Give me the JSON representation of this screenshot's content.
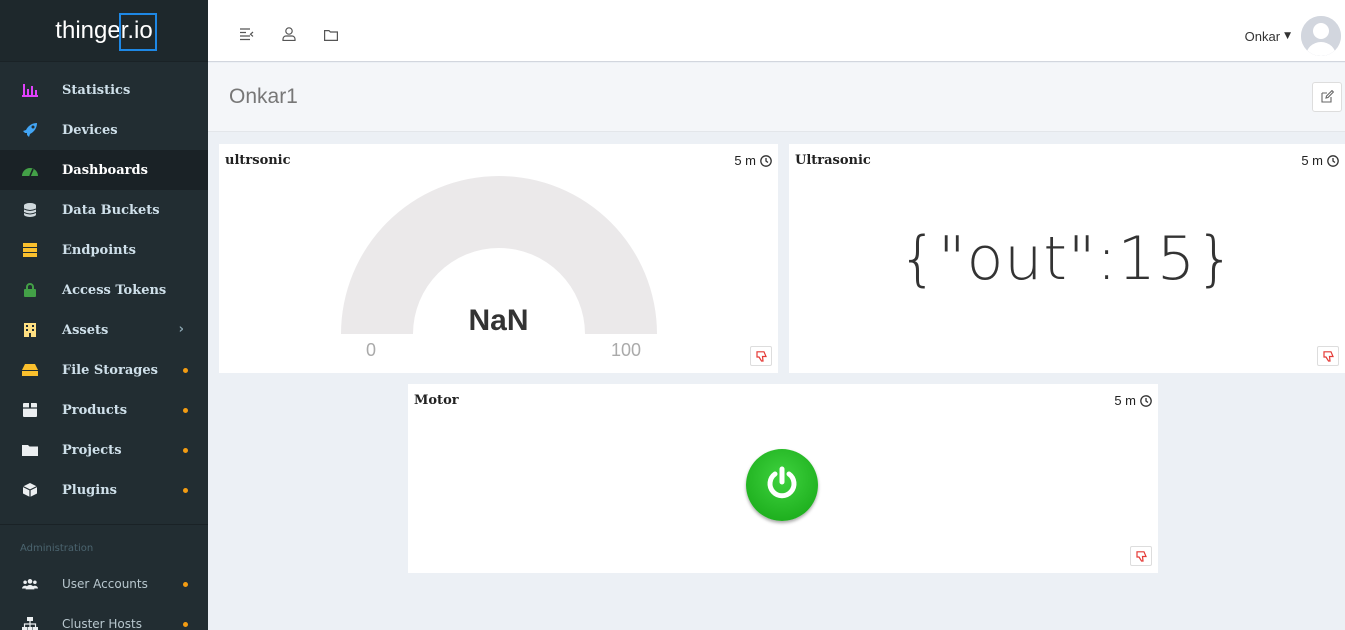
{
  "app": {
    "logo_text": "thinger.io"
  },
  "sidebar": {
    "items": [
      {
        "label": "Statistics"
      },
      {
        "label": "Devices"
      },
      {
        "label": "Dashboards"
      },
      {
        "label": "Data Buckets"
      },
      {
        "label": "Endpoints"
      },
      {
        "label": "Access Tokens"
      },
      {
        "label": "Assets"
      },
      {
        "label": "File Storages"
      },
      {
        "label": "Products"
      },
      {
        "label": "Projects"
      },
      {
        "label": "Plugins"
      }
    ],
    "admin_header": "Administration",
    "admin_items": [
      {
        "label": "User Accounts"
      },
      {
        "label": "Cluster Hosts"
      }
    ]
  },
  "topbar": {
    "user_name": "Onkar"
  },
  "page": {
    "title": "Onkar1"
  },
  "widgets": {
    "gauge": {
      "title": "ultrsonic",
      "interval": "5 m",
      "value": "NaN",
      "min": "0",
      "max": "100"
    },
    "text": {
      "title": "Ultrasonic",
      "interval": "5 m",
      "value": "{\"out\":15}"
    },
    "motor": {
      "title": "Motor",
      "interval": "5 m"
    }
  },
  "colors": {
    "sidebar_bg": "#222d32",
    "accent_blue": "#1e88e5",
    "power_green": "#1cb81c",
    "flag_red": "#e53935",
    "dot_orange": "#f39c12"
  }
}
